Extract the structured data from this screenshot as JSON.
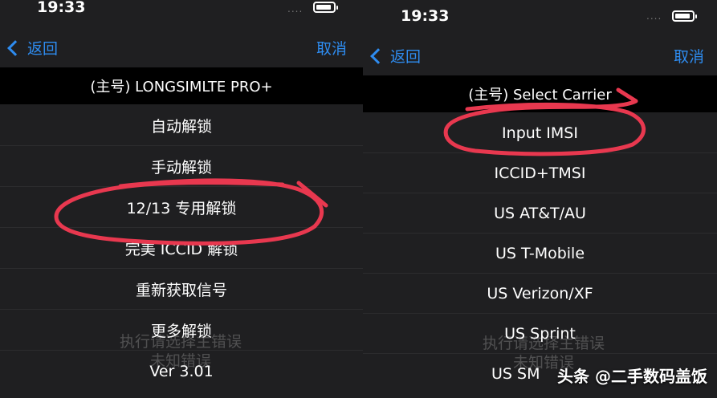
{
  "left": {
    "status": {
      "time": "19:33",
      "signal": "....",
      "battery": "battery-icon"
    },
    "nav": {
      "back": "返回",
      "cancel": "取消"
    },
    "header": "(主号) LONGSIMLTE PRO+",
    "items": [
      {
        "label": "自动解锁"
      },
      {
        "label": "手动解锁"
      },
      {
        "label": "12/13 专用解锁"
      },
      {
        "label": "完美 ICCID 解锁"
      },
      {
        "label": "重新获取信号"
      },
      {
        "label": "更多解锁"
      },
      {
        "label": "Ver 3.01"
      }
    ],
    "ghost_lines": [
      "执行请选择主错误",
      "未知错误"
    ]
  },
  "right": {
    "status": {
      "time": "19:33",
      "signal": "....",
      "battery": "battery-icon"
    },
    "nav": {
      "back": "返回",
      "cancel": "取消"
    },
    "header": "(主号) Select Carrier",
    "items": [
      {
        "label": "Input IMSI"
      },
      {
        "label": "ICCID+TMSI"
      },
      {
        "label": "US AT&T/AU"
      },
      {
        "label": "US T-Mobile"
      },
      {
        "label": "US Verizon/XF"
      },
      {
        "label": "US Sprint"
      },
      {
        "label": "US SM"
      }
    ],
    "ghost_lines": [
      "执行请选择主错误",
      "未知错误"
    ]
  },
  "watermark": "头条 @二手数码盖饭",
  "annotation_color": "#e8384f"
}
